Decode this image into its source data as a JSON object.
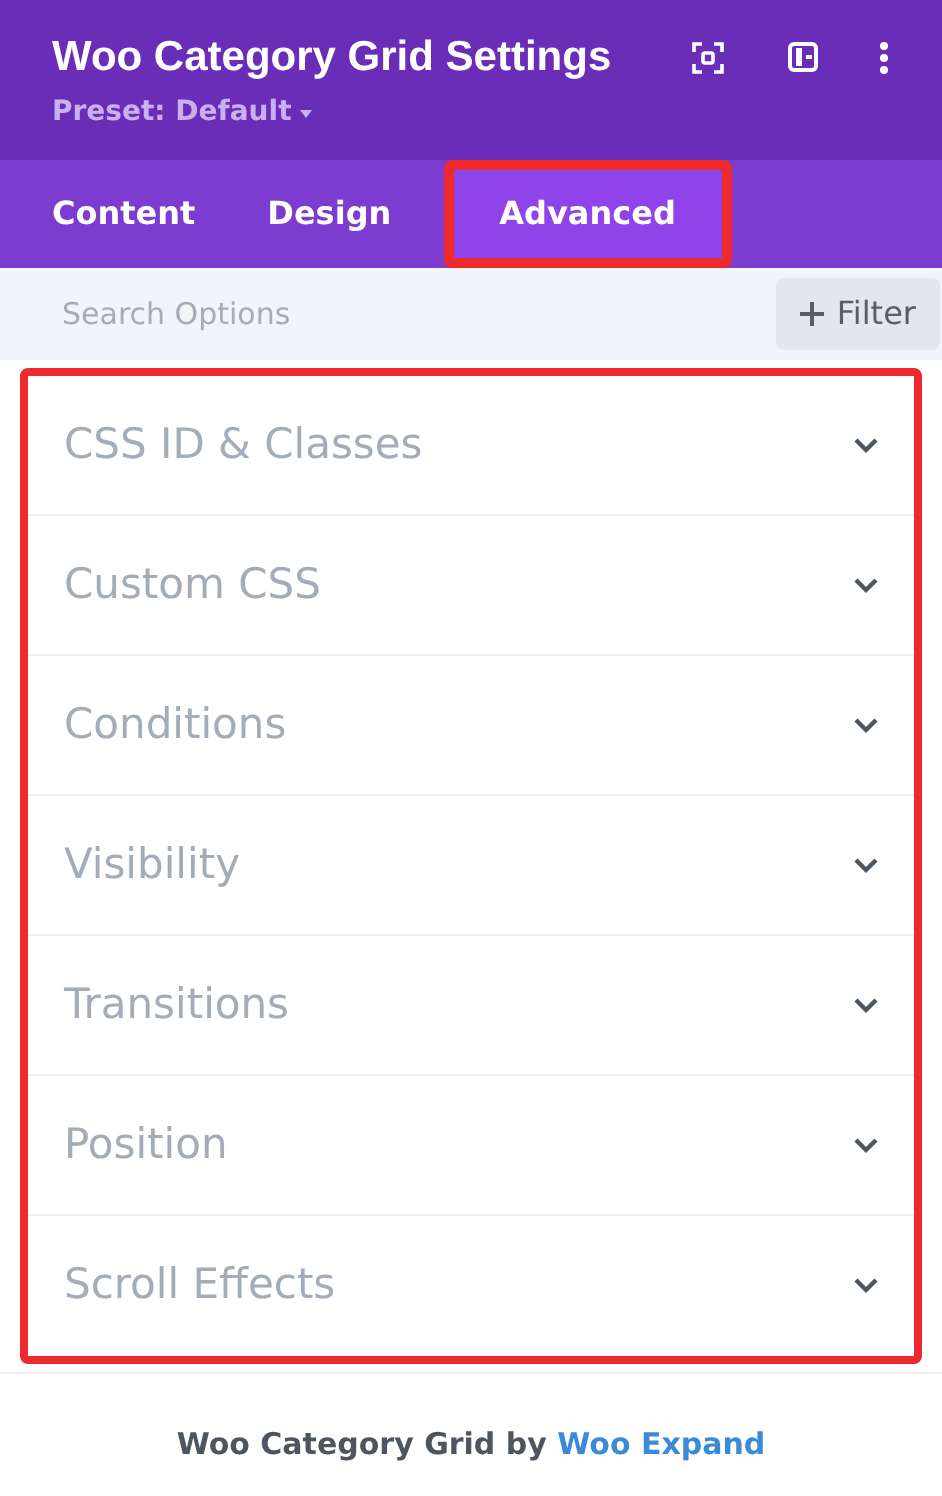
{
  "header": {
    "title": "Woo Category Grid Settings",
    "preset": "Preset: Default"
  },
  "tabs": [
    {
      "label": "Content",
      "selected": false,
      "highlighted": false
    },
    {
      "label": "Design",
      "selected": false,
      "highlighted": false
    },
    {
      "label": "Advanced",
      "selected": true,
      "highlighted": true
    }
  ],
  "search": {
    "placeholder": "Search Options",
    "filter_button": "Filter"
  },
  "sections_highlighted": true,
  "sections": [
    {
      "label": "CSS ID & Classes",
      "expanded": false
    },
    {
      "label": "Custom CSS",
      "expanded": false
    },
    {
      "label": "Conditions",
      "expanded": false
    },
    {
      "label": "Visibility",
      "expanded": false
    },
    {
      "label": "Transitions",
      "expanded": false
    },
    {
      "label": "Position",
      "expanded": false
    },
    {
      "label": "Scroll Effects",
      "expanded": false
    }
  ],
  "footer": {
    "text": "Woo Category Grid by ",
    "link": "Woo Expand"
  }
}
